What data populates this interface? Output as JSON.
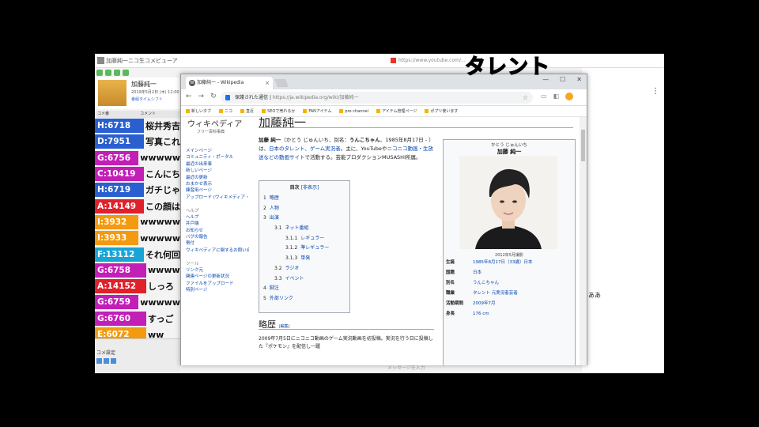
{
  "overlay": {
    "caption": "タレント"
  },
  "bg_app": {
    "title": "加藤純一ニコ生コメビューア",
    "profile": {
      "name": "加藤純一",
      "sub1": "2019年5月2日 (木) 12:00",
      "sub2": "番組タイムシフト"
    },
    "columns": [
      "コメ番",
      "コメント"
    ],
    "comments": [
      {
        "id": "H:6718",
        "text": "桜井秀吉",
        "color": "#2a5fd1"
      },
      {
        "id": "D:7951",
        "text": "写真これ",
        "color": "#2a5fd1"
      },
      {
        "id": "G:6756",
        "text": "wwwww",
        "color": "#c21fb6"
      },
      {
        "id": "C:10419",
        "text": "こんにち",
        "color": "#c21fb6"
      },
      {
        "id": "H:6719",
        "text": "ガチじゃ",
        "color": "#2a5fd1"
      },
      {
        "id": "A:14149",
        "text": "この顔は",
        "color": "#e0202a"
      },
      {
        "id": "I:3932",
        "text": "wwwww",
        "color": "#f39a10"
      },
      {
        "id": "I:3933",
        "text": "wwwww",
        "color": "#f39a10"
      },
      {
        "id": "F:13112",
        "text": "それ何回",
        "color": "#1aa4d6"
      },
      {
        "id": "G:6758",
        "text": "wwww",
        "color": "#c21fb6"
      },
      {
        "id": "A:14152",
        "text": "しっろ",
        "color": "#e0202a"
      },
      {
        "id": "G:6759",
        "text": "wwwww",
        "color": "#c21fb6"
      },
      {
        "id": "G:6760",
        "text": "すっご",
        "color": "#c21fb6"
      },
      {
        "id": "E:6072",
        "text": "ww",
        "color": "#f39a10"
      }
    ],
    "bottom_label": "コメ設定",
    "right_text": "あああ",
    "right_tab": "https://www.youtube.com/...",
    "status": "メッセージを入力"
  },
  "chrome": {
    "tab_title": "加藤純一 - Wikipedia",
    "url_secure": "保護された通信",
    "url": "https://ja.wikipedia.org/wiki/加藤純一",
    "bookmarks": [
      "新しいタブ",
      "ニコ",
      "",
      "直近",
      "SEOで売れるか",
      "FANアイテム",
      "pro channel",
      "アイテム管理ページ",
      "ポプリ使います"
    ]
  },
  "wiki": {
    "logo_title": "ウィキペディア",
    "logo_sub": "フリー百科事典",
    "sidebar": [
      "メインページ",
      "コミュニティ・ポータル",
      "最近の出来事",
      "新しいページ",
      "最近の更新",
      "おまかせ表示",
      "練習用ページ",
      "アップロード (ウィキメディア・コモンズ)",
      "",
      "ヘルプ",
      "ヘルプ",
      "井戸端",
      "お知らせ",
      "バグの報告",
      "寄付",
      "ウィキペディアに関するお問い合わせ",
      "",
      "ツール",
      "リンク元",
      "関連ページの更新状況",
      "ファイルをアップロード",
      "特別ページ"
    ],
    "title": "加藤純一",
    "lead": [
      {
        "t": "加藤 純一",
        "b": true
      },
      {
        "t": "（かとう じゅんいち、別名："
      },
      {
        "t": "うんこちゃん",
        "b": true
      },
      {
        "t": "、1985年8月17日 - ）は、"
      },
      {
        "t": "日本のタレント、ゲーム実況者",
        "l": true
      },
      {
        "t": "。主に、YouTubeや"
      },
      {
        "t": "ニコニコ動画・生放送などの動画サイト",
        "l": true
      },
      {
        "t": "で活動する。芸能プロダクションMUSASHI所属。"
      }
    ],
    "toc": {
      "title": "目次",
      "hide": "[非表示]",
      "items": [
        {
          "n": "1",
          "t": "略歴",
          "lv": 0
        },
        {
          "n": "2",
          "t": "人物",
          "lv": 0
        },
        {
          "n": "3",
          "t": "出演",
          "lv": 0
        },
        {
          "n": "3.1",
          "t": "ネット番組",
          "lv": 1
        },
        {
          "n": "3.1.1",
          "t": "レギュラー",
          "lv": 2
        },
        {
          "n": "3.1.2",
          "t": "準レギュラー",
          "lv": 2
        },
        {
          "n": "3.1.3",
          "t": "単発",
          "lv": 2
        },
        {
          "n": "3.2",
          "t": "ラジオ",
          "lv": 1
        },
        {
          "n": "3.3",
          "t": "イベント",
          "lv": 1
        },
        {
          "n": "4",
          "t": "脚注",
          "lv": 0
        },
        {
          "n": "5",
          "t": "外部リンク",
          "lv": 0
        }
      ]
    },
    "h2": "略歴",
    "h2_edit": "[編集]",
    "history": "2009年7月5日にニコニコ動画のゲーム実況動画を初投稿。実況を行う日に投稿した『ポケモン』を配信し一躍",
    "infobox": {
      "kana": "かとう じゅんいち",
      "name": "加藤 純一",
      "caption": "2012年5月撮影",
      "rows": [
        {
          "k": "生誕",
          "v": "1985年8月17日（33歳）日本"
        },
        {
          "k": "国籍",
          "v": "日本"
        },
        {
          "k": "別名",
          "v": "うんこちゃん"
        },
        {
          "k": "職業",
          "v": "タレント 元実況者芸者"
        },
        {
          "k": "活動期間",
          "v": "2009年7月"
        },
        {
          "k": "身長",
          "v": "176 cm"
        }
      ]
    }
  }
}
